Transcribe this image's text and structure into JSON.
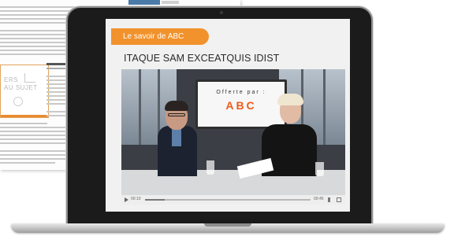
{
  "slide": {
    "label": "Le savoir de ABC",
    "headline": "ITAQUE SAM EXCEATQUIS IDIST"
  },
  "video": {
    "panel_line1": "Offerte par :",
    "panel_line2": "ABC",
    "time_current": "00:10",
    "time_total": "00:45",
    "progress": 0.12
  },
  "icons": {
    "play": "play-icon",
    "volume": "volume-icon",
    "fullscreen": "fullscreen-icon"
  },
  "colors": {
    "label_bg": "#f1922c",
    "brand": "#ee5a1a",
    "screen_bg": "#f1f1f1",
    "bezel": "#1b1b1b"
  }
}
